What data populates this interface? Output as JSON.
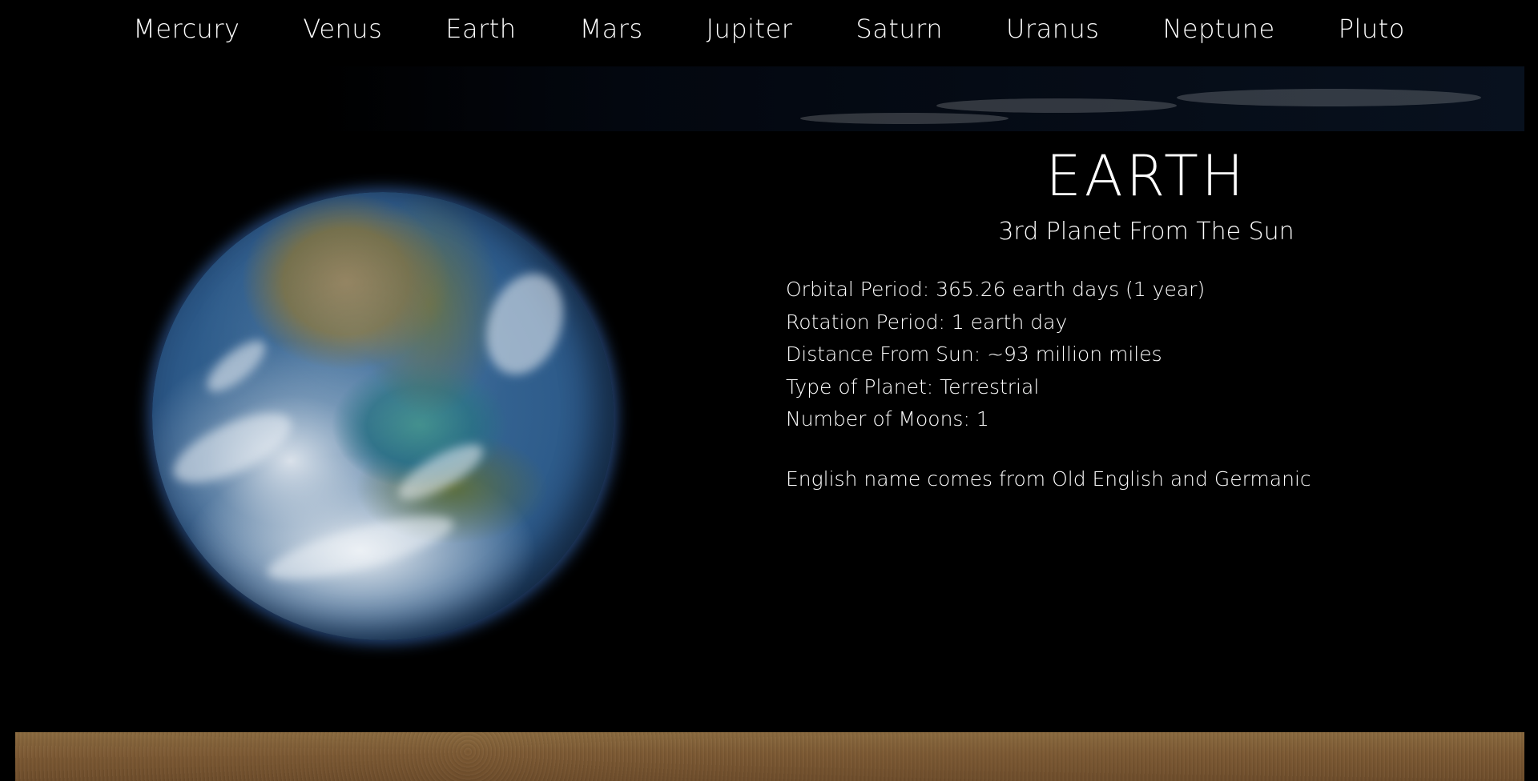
{
  "nav": {
    "items": [
      "Mercury",
      "Venus",
      "Earth",
      "Mars",
      "Jupiter",
      "Saturn",
      "Uranus",
      "Neptune",
      "Pluto"
    ],
    "active": "Earth"
  },
  "planet": {
    "title": "EARTH",
    "subtitle": "3rd Planet From The Sun",
    "facts": [
      "Orbital Period: 365.26 earth days (1 year)",
      "Rotation Period: 1 earth day",
      "Distance From Sun: ~93 million miles",
      "Type of Planet: Terrestrial",
      "Number of Moons: 1"
    ],
    "etymology": "English name comes from Old English and Germanic"
  },
  "colors": {
    "background": "#000000",
    "text": "#ffffff",
    "atmosphere_glow": "#4f88e0",
    "ground": "#7d5a34"
  },
  "icons": {
    "header_banner": "earth-horizon-image",
    "planet_image": "earth-globe-image",
    "footer_banner": "planet-surface-image"
  }
}
